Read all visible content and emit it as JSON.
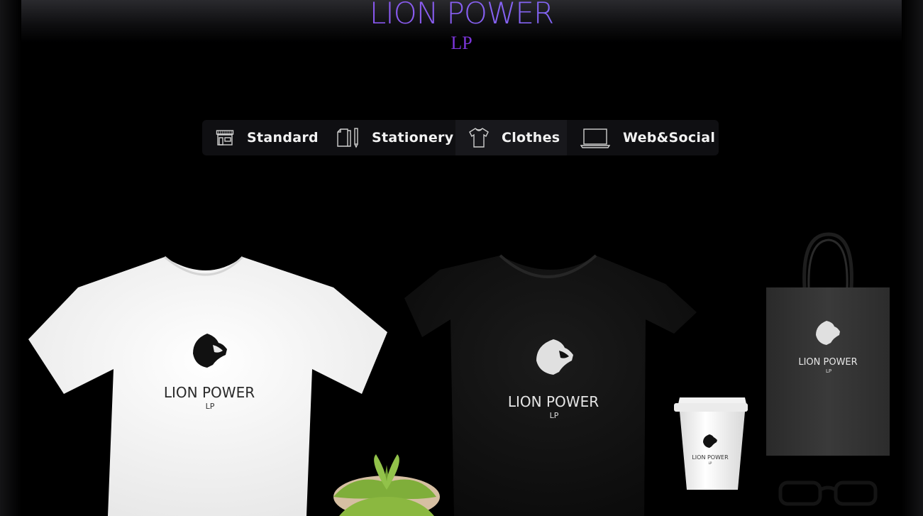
{
  "brand": {
    "title": "LION POWER",
    "subtitle": "LP"
  },
  "nav": {
    "items": [
      {
        "label": "Standard",
        "icon": "storefront-icon"
      },
      {
        "label": "Stationery",
        "icon": "stationery-icon"
      },
      {
        "label": "Clothes",
        "icon": "tshirt-icon",
        "active": true
      },
      {
        "label": "Web&Social",
        "icon": "laptop-icon"
      }
    ]
  },
  "mockups": {
    "white_tshirt": {
      "title": "LION POWER",
      "subtitle": "LP"
    },
    "black_tshirt": {
      "title": "LION POWER",
      "subtitle": "LP"
    },
    "cup": {
      "title": "LION POWER",
      "subtitle": "LP"
    },
    "bag": {
      "title": "LION POWER",
      "subtitle": "LP"
    }
  },
  "colors": {
    "accent_purple": "#7a35d8",
    "accent_blue": "#6d7dff",
    "background": "#000000",
    "nav_background": "#0f0f12"
  }
}
